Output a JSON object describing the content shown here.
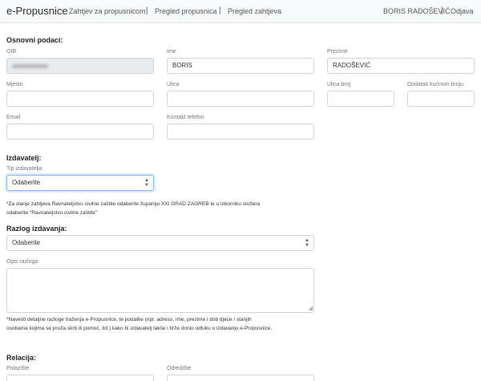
{
  "navbar": {
    "brand": "e-Propusnice",
    "links": [
      "Zahtjev za propusnicom",
      "Pregled propusnica",
      "Pregled zahtjeva"
    ],
    "separator": "|",
    "user": "BORIS RADOŠEVIĆ",
    "logout": "Odjava"
  },
  "basic": {
    "title": "Osnovni podaci:",
    "oib_label": "OIB",
    "ime_label": "Ime",
    "ime_value": "BORIS",
    "prezime_label": "Prezime",
    "prezime_value": "RADOŠEVIĆ",
    "mjesto_label": "Mjesto",
    "ulica_label": "Ulica",
    "ulica_broj_label": "Ulica broj",
    "dodatak_label": "Dodatak kućnom broju",
    "email_label": "Email",
    "kontakt_label": "Kontakt telefon"
  },
  "izdavatelj": {
    "title": "Izdavatelj:",
    "tip_label": "Tip izdavatelja",
    "tip_value": "Odaberite",
    "note_line1": "*Za slanje zahtjeva Ravnateljstvu civilne zaštite odaberite županiju XXI GRAD ZAGREB te u izborniku stožera",
    "note_line2": "odaberite \"Ravnateljstvo civilne zaštite\""
  },
  "razlog": {
    "title": "Razlog izdavanja:",
    "value": "Odaberite",
    "opis_label": "Opis razloga",
    "note_line1": "*Navesti detaljne razloge traženja e-Propusnice, te podatke (npr. adresu, ime, prezime i dob djece / stanjih",
    "note_line2": "osobama kojima se pruža skrb ili pomoć, itd.) kako bi izdavatelj lakše i brže donio odluku o izdavanju e-Propusnice."
  },
  "relacija": {
    "title": "Relacija:",
    "polaziste_label": "Polazište",
    "odrediste_label": "Odredište"
  },
  "icons": {
    "select_up": "▲",
    "select_down": "▼",
    "resize": "◢"
  }
}
